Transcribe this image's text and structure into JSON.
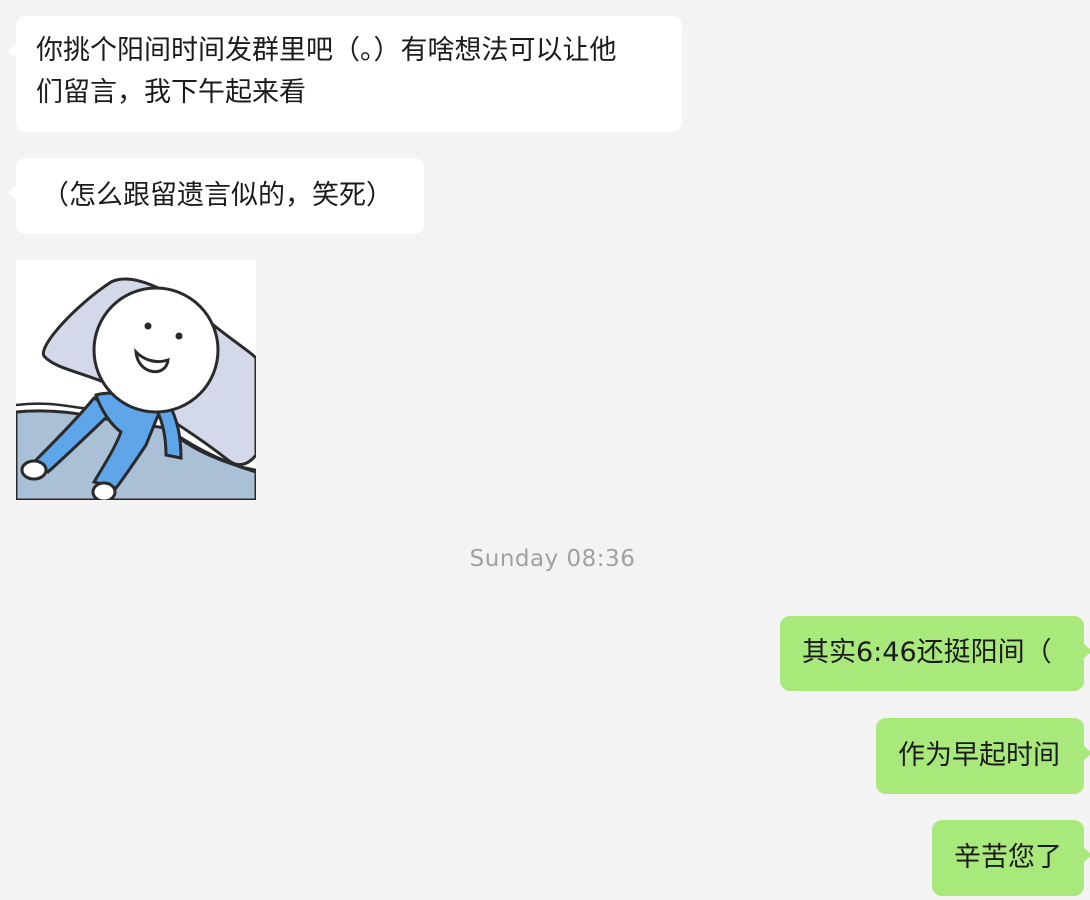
{
  "messages": [
    {
      "id": "m1",
      "direction": "incoming",
      "lines": [
        "你挑个阳间时间发群里吧（。）有啥想法可以让他",
        "们留言，我下午起来看"
      ]
    },
    {
      "id": "m2",
      "direction": "incoming",
      "text": "（怎么跟留遗言似的，笑死）"
    },
    {
      "id": "sticker",
      "direction": "incoming",
      "type": "sticker",
      "icon": "lying-in-bed-smiling-sticker",
      "colors": {
        "pajamas": "#5ea5ea",
        "pillow": "#d4d9ea",
        "blanket": "#a9c0d6",
        "sheet": "#ffffff",
        "outline": "#2a2a2a"
      }
    },
    {
      "id": "m3",
      "direction": "outgoing",
      "text": "其实6:46还挺阳间（"
    },
    {
      "id": "m4",
      "direction": "outgoing",
      "text": "作为早起时间"
    },
    {
      "id": "m5",
      "direction": "outgoing",
      "text": "辛苦您了"
    }
  ],
  "timestamp": "Sunday 08:36",
  "colors": {
    "background": "#f3f3f3",
    "incoming_bubble": "#ffffff",
    "outgoing_bubble": "#a9e87a",
    "timestamp_text": "#a0a0a0"
  }
}
